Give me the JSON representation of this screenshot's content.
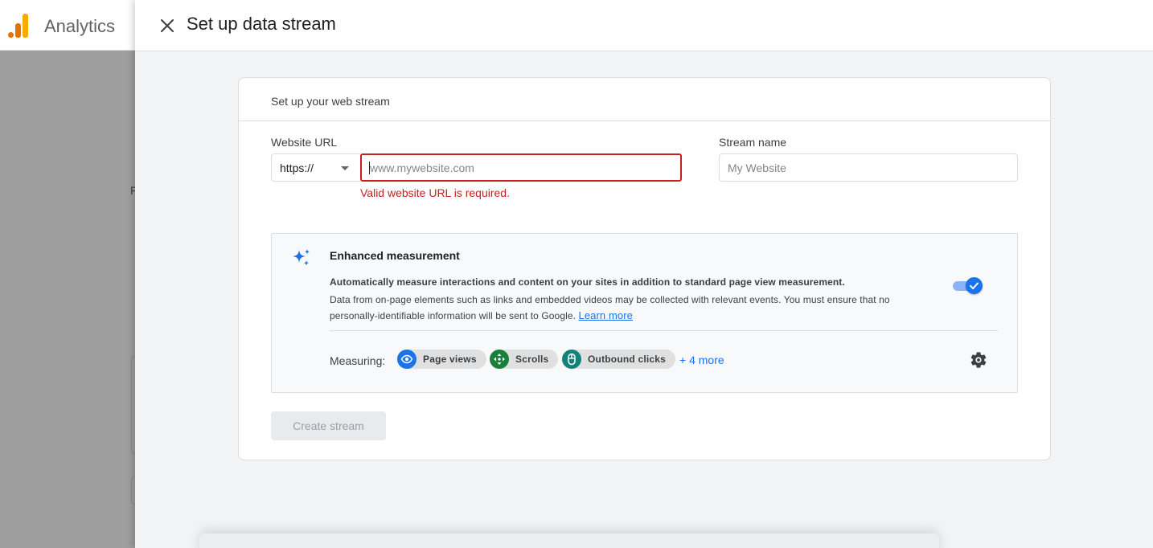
{
  "app": {
    "name": "Analytics",
    "background_ghost_letter": "F"
  },
  "panel": {
    "title": "Set up data stream",
    "close_icon": "close-icon"
  },
  "card": {
    "heading": "Set up your web stream",
    "website_url": {
      "label": "Website URL",
      "protocol_value": "https://",
      "placeholder": "www.mywebsite.com",
      "value": "",
      "error": "Valid website URL is required."
    },
    "stream_name": {
      "label": "Stream name",
      "placeholder": "My Website",
      "value": ""
    },
    "enhanced_measurement": {
      "icon": "sparkle-icon",
      "title": "Enhanced measurement",
      "description_bold": "Automatically measure interactions and content on your sites in addition to standard page view measurement.",
      "description": "Data from on-page elements such as links and embedded videos may be collected with relevant events. You must ensure that no personally-identifiable information will be sent to Google.",
      "learn_more": "Learn more",
      "enabled": true,
      "measuring_label": "Measuring:",
      "chips": [
        {
          "label": "Page views",
          "icon": "eye-icon",
          "color": "#1a73e8"
        },
        {
          "label": "Scrolls",
          "icon": "scroll-arrows-icon",
          "color": "#188038"
        },
        {
          "label": "Outbound clicks",
          "icon": "mouse-icon",
          "color": "#12837a"
        }
      ],
      "more_link": "+ 4 more",
      "settings_icon": "gear-icon"
    },
    "create_button": "Create stream",
    "create_button_disabled": true
  },
  "colors": {
    "accent": "#1a73e8",
    "error": "#c5221f",
    "analytics_orange": "#e37400",
    "analytics_yellow": "#f9ab00"
  }
}
